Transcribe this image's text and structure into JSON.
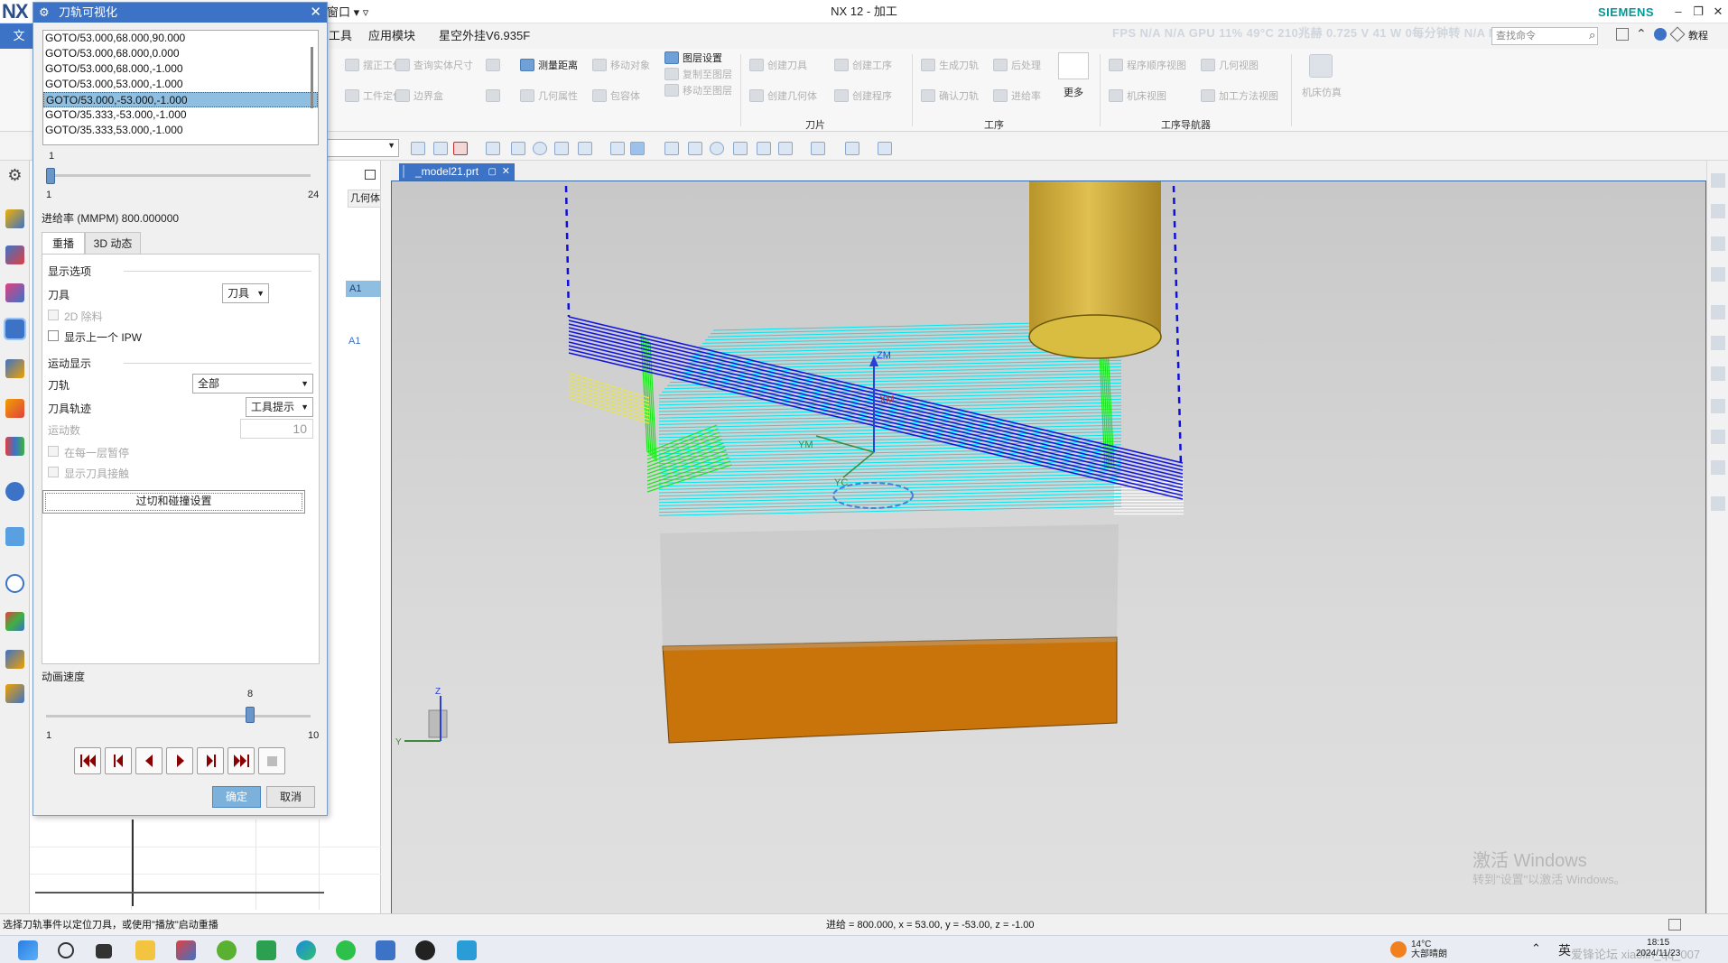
{
  "window": {
    "app_logo": "NX",
    "title": "NX 12 - 加工",
    "brand": "SIEMENS",
    "perf_overlay": "FPS N/A N/A GPU 11% 49°C 210兆赫 0.725 V 41 W 0每分钟转 N/A N/A N/A",
    "min_glyph": "–",
    "restore_glyph": "❐",
    "close_glyph": "✕"
  },
  "menubar": {
    "file": "文",
    "window_fragment": "窗口 ▾ ▿",
    "items": [
      "工具",
      "应用模块",
      "星空外挂V6.935F"
    ],
    "search_placeholder": "查找命令",
    "help_label": "教程"
  },
  "ribbon": {
    "buttons_col1": [
      "摆正工件",
      "工件定位"
    ],
    "buttons_col2": [
      "查询实体尺寸",
      "边界盒"
    ],
    "buttons_col3": [
      "测量距离",
      "几何属性"
    ],
    "buttons_col4": [
      "移动对象",
      "包容体"
    ],
    "buttons_col5": [
      "图层设置",
      "复制至图层",
      "移动至图层"
    ],
    "tool_group": [
      "创建刀具",
      "创建工序",
      "创建几何体",
      "创建程序"
    ],
    "op_group": [
      "生成刀轨",
      "后处理",
      "确认刀轨",
      "进给率"
    ],
    "more_label": "更多",
    "nav_group": [
      "程序顺序视图",
      "几何视图",
      "机床视图",
      "加工方法视图"
    ],
    "sim_label": "机床仿真",
    "group_labels": {
      "tool": "刀片",
      "operation": "工序",
      "navigator": "工序导航器"
    }
  },
  "navigator": {
    "col_header": "几何体",
    "highlight": "A1",
    "second": "A1"
  },
  "dialog": {
    "title": "刀轨可视化",
    "events": [
      "GOTO/53.000,68.000,90.000",
      "GOTO/53.000,68.000,0.000",
      "GOTO/53.000,68.000,-1.000",
      "GOTO/53.000,53.000,-1.000",
      "GOTO/53.000,-53.000,-1.000",
      "GOTO/35.333,-53.000,-1.000",
      "GOTO/35.333,53.000,-1.000"
    ],
    "selected_event_index": 4,
    "event_slider": {
      "value": "1",
      "min": "1",
      "max": "24",
      "fraction": 0.0
    },
    "feed_rate": "进给率 (MMPM) 800.000000",
    "tabs": [
      "重播",
      "3D 动态"
    ],
    "display_options": "显示选项",
    "tool_label": "刀具",
    "tool_value": "刀具",
    "remove_2d": "2D 除料",
    "show_prev_ipw": "显示上一个 IPW",
    "motion_display": "运动显示",
    "path_label": "刀轨",
    "path_value": "全部",
    "trace_label": "刀具轨迹",
    "trace_value": "工具提示",
    "motion_count_label": "运动数",
    "motion_count_value": "10",
    "pause_each_layer": "在每一层暂停",
    "show_tool_contact": "显示刀具接触",
    "collision_button": "过切和碰撞设置",
    "anim_speed_label": "动画速度",
    "anim_slider": {
      "value": "8",
      "min": "1",
      "max": "10",
      "fraction": 0.78
    },
    "ok": "确定",
    "cancel": "取消"
  },
  "graphics": {
    "doc_tab": "_model21.prt",
    "axis_labels": {
      "zm": "ZM",
      "xm": "XM",
      "ym": "YM",
      "yc": "YC",
      "z": "Z",
      "y": "Y"
    },
    "activate_title": "激活 Windows",
    "activate_sub": "转到\"设置\"以激活 Windows。"
  },
  "status": {
    "left": "选择刀轨事件以定位刀具，或使用\"播放\"启动重播",
    "mid": "进给 = 800.000, x = 53.00, y = -53.00, z = -1.00"
  },
  "taskbar": {
    "weather_temp": "14°C",
    "weather_desc": "大部晴朗",
    "tray": "英",
    "time": "18:15",
    "date": "2024/11/23",
    "watermark": "爱锋论坛 xiaolin_qq_007"
  },
  "colors": {
    "accent": "#3d73c7",
    "brand": "#009999",
    "toolpath_blue": "#1414e0",
    "toolpath_cyan": "#00e6f0",
    "toolpath_green": "#1ee61e",
    "tool_holder": "#d8b640",
    "stock": "#cf7a0c"
  }
}
